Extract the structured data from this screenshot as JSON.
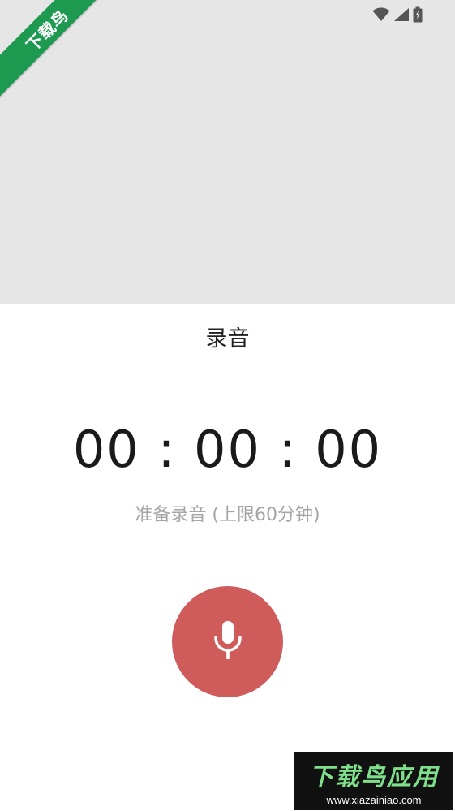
{
  "ribbon": {
    "label": "下载鸟"
  },
  "status_bar": {
    "icons": [
      "wifi-icon",
      "signal-icon",
      "battery-charging-icon"
    ]
  },
  "record_sheet": {
    "title": "录音",
    "timer": "00 : 00 : 00",
    "status_text": "准备录音 (上限60分钟)",
    "button_icon": "microphone-icon",
    "button_color": "#d05b5b"
  },
  "watermark": {
    "main": "下载鸟应用",
    "sub": "www.xiazainiao.com"
  }
}
